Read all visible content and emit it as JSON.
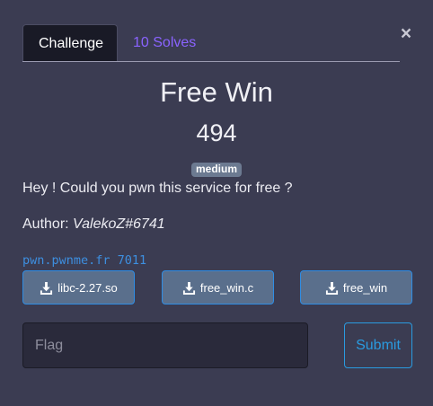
{
  "tabs": {
    "challenge": "Challenge",
    "solves": "10 Solves"
  },
  "close_icon": "×",
  "challenge": {
    "name": "Free Win",
    "value": "494",
    "difficulty": "medium",
    "description": "Hey ! Could you pwn this service for free ?",
    "author_label": "Author:",
    "author_name": "ValekoZ#6741",
    "connection": "pwn.pwnme.fr 7011"
  },
  "files": [
    {
      "name": "libc-2.27.so",
      "icon": "download-icon"
    },
    {
      "name": "free_win.c",
      "icon": "download-icon"
    },
    {
      "name": "free_win",
      "icon": "download-icon"
    }
  ],
  "flag_form": {
    "placeholder": "Flag",
    "value": "",
    "submit_label": "Submit"
  },
  "colors": {
    "background": "#3b3c52",
    "active_tab": "#191a26",
    "link": "#8a63ff",
    "connection": "#3d8fe0",
    "badge": "#6c7a91",
    "file_button": "#5a6f8c",
    "submit": "#2a9be0"
  }
}
